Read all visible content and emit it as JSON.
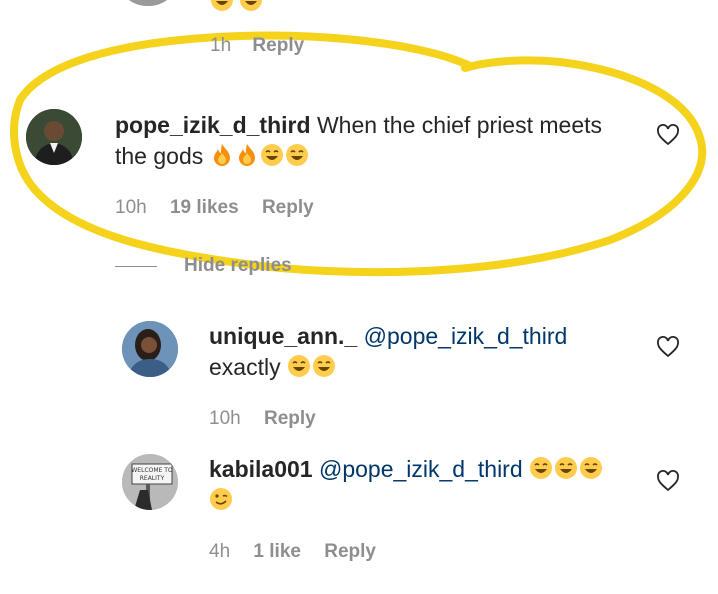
{
  "top_comment": {
    "time": "1h",
    "reply_label": "Reply"
  },
  "comment_main": {
    "username": "pope_izik_d_third",
    "text_line1": "When the chief priest meets",
    "text_line2": "the gods",
    "emojis": [
      "fire-emoji",
      "fire-emoji",
      "laughing-emoji",
      "laughing-emoji"
    ],
    "time": "10h",
    "likes": "19 likes",
    "reply_label": "Reply",
    "hide_replies_label": "Hide replies"
  },
  "replies": [
    {
      "username": "unique_ann._",
      "mention": "@pope_izik_d_third",
      "text": "exactly",
      "time": "10h",
      "reply_label": "Reply"
    },
    {
      "username": "kabila001",
      "mention": "@pope_izik_d_third",
      "time": "4h",
      "likes": "1 like",
      "reply_label": "Reply",
      "avatar_sign_text": "WELCOME TO REALITY"
    }
  ],
  "colors": {
    "highlight": "#f5d31c",
    "username": "#262626",
    "mention": "#00376b",
    "meta": "#8e8e8e"
  }
}
